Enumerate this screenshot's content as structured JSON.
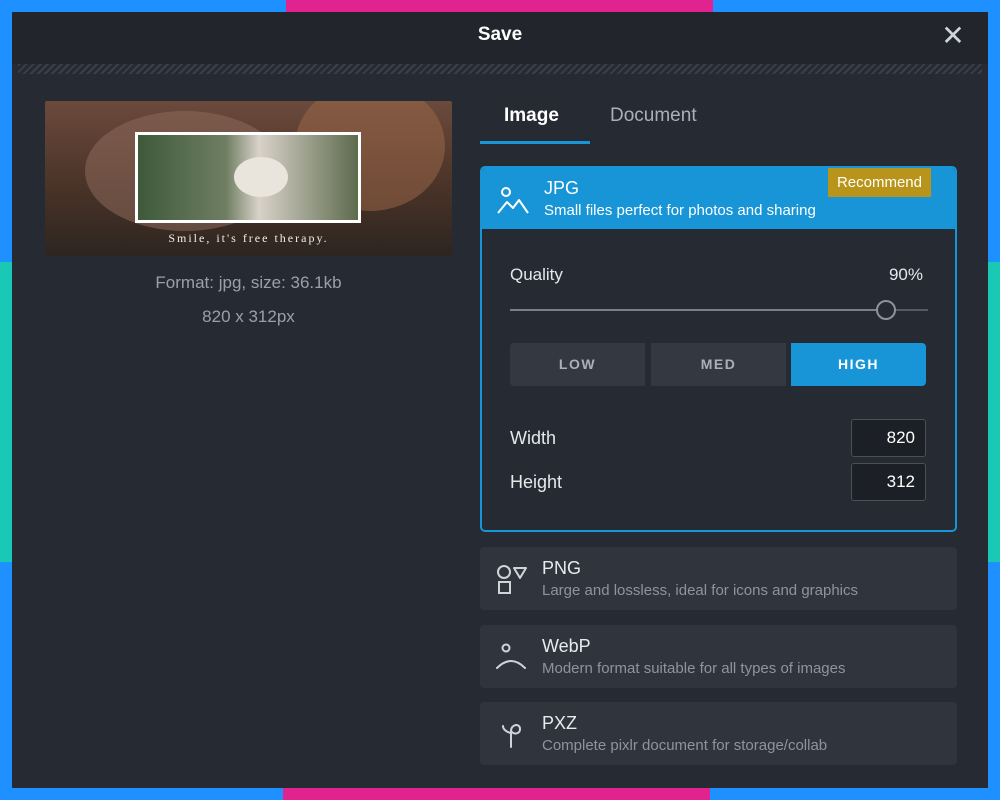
{
  "dialog": {
    "title": "Save"
  },
  "preview": {
    "caption": "Smile, it's free therapy.",
    "file_info": "Format: jpg, size: 36.1kb",
    "dimensions": "820 x 312px"
  },
  "tabs": [
    {
      "label": "Image",
      "active": true
    },
    {
      "label": "Document",
      "active": false
    }
  ],
  "jpg": {
    "name": "JPG",
    "description": "Small files perfect for photos and sharing",
    "badge": "Recommend",
    "icon": "image-icon",
    "quality_label": "Quality",
    "quality_value": "90%",
    "quality_fraction": 0.9,
    "presets": [
      "LOW",
      "MED",
      "HIGH"
    ],
    "selected_preset": "HIGH",
    "width_label": "Width",
    "width_value": "820",
    "height_label": "Height",
    "height_value": "312"
  },
  "formats": [
    {
      "name": "PNG",
      "description": "Large and lossless, ideal for icons and graphics",
      "icon": "shapes-icon"
    },
    {
      "name": "WebP",
      "description": "Modern format suitable for all types of images",
      "icon": "webp-icon"
    },
    {
      "name": "PXZ",
      "description": "Complete pixlr document for storage/collab",
      "icon": "pixlr-icon"
    }
  ],
  "colors": {
    "accent": "#1795d6",
    "badge": "#b8941a",
    "background": "#262a33"
  }
}
